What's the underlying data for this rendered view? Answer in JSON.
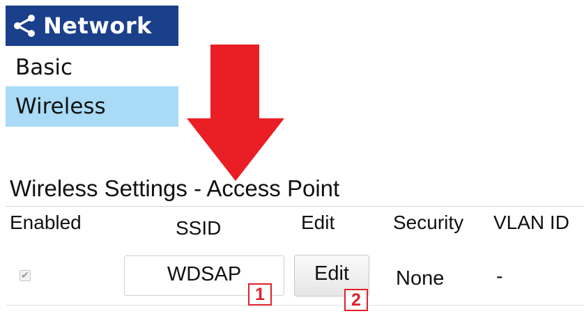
{
  "sidebar": {
    "header": {
      "title": "Network",
      "icon": "share-icon",
      "background": "#1a3f8b"
    },
    "items": [
      {
        "label": "Basic",
        "selected": false
      },
      {
        "label": "Wireless",
        "selected": true,
        "highlight": "#a9dbf7"
      }
    ]
  },
  "annotation": {
    "arrow_icon": "down-arrow-icon",
    "arrow_color": "#ea1f25",
    "badges": [
      "1",
      "2"
    ],
    "badge_color": "#e0202a"
  },
  "section": {
    "title": "Wireless Settings - Access Point"
  },
  "table": {
    "headers": {
      "enabled": "Enabled",
      "ssid": "SSID",
      "edit": "Edit",
      "security": "Security",
      "vlan_id": "VLAN ID"
    },
    "rows": [
      {
        "enabled": true,
        "ssid": "WDSAP",
        "edit_label": "Edit",
        "security": "None",
        "vlan_id": "-"
      }
    ]
  }
}
